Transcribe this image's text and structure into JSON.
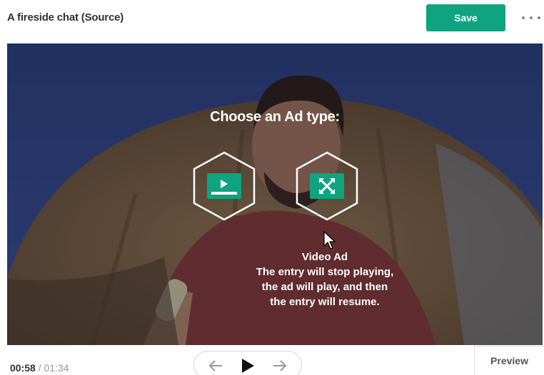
{
  "header": {
    "title": "A fireside chat (Source)",
    "save_label": "Save"
  },
  "player": {
    "prompt": "Choose an Ad type:",
    "ad_types": [
      {
        "icon": "video-ad-icon"
      },
      {
        "icon": "expand-arrows-icon"
      }
    ],
    "description": {
      "heading": "Video Ad",
      "lines": [
        "The entry will stop playing,",
        "the ad will play, and then",
        "the entry will resume."
      ]
    }
  },
  "timeline": {
    "current": "00:58",
    "separator": "/",
    "total": "01:34"
  },
  "controls": {
    "prev_icon": "arrow-left-icon",
    "play_icon": "play-icon",
    "next_icon": "arrow-right-icon"
  },
  "preview_label": "Preview",
  "colors": {
    "accent": "#0fa37f"
  }
}
